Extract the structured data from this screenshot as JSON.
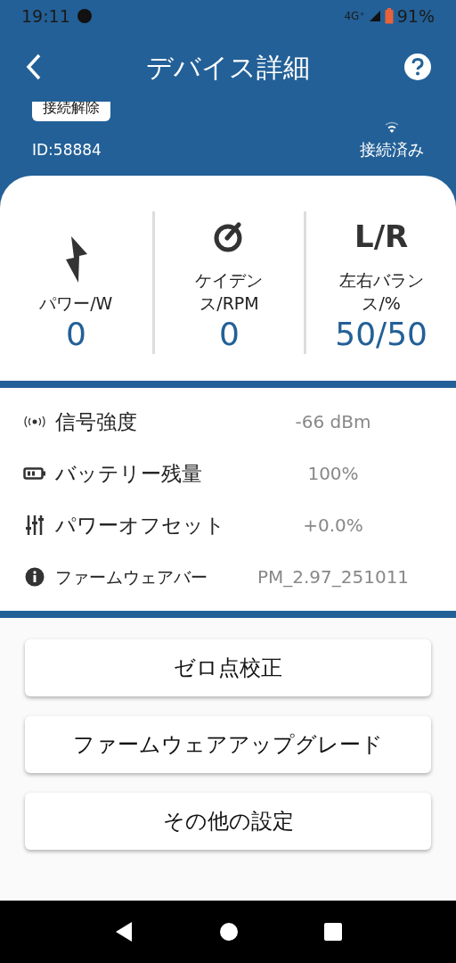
{
  "status_bar": {
    "time": "19:11",
    "network": "4G⁺",
    "battery": "91%"
  },
  "header": {
    "title": "デバイス詳細"
  },
  "device": {
    "disconnect_button": "接続解除",
    "id": "ID:58884",
    "connection": "接続済み"
  },
  "metrics": [
    {
      "kind": "power",
      "label": "パワー/W",
      "value": "0"
    },
    {
      "kind": "cadence",
      "label": "ケイデンス/RPM",
      "value": "0"
    },
    {
      "kind": "balance",
      "icon_text": "L/R",
      "label": "左右バランス/%",
      "value": "50/50"
    }
  ],
  "info": [
    {
      "kind": "signal",
      "label": "信号強度",
      "value": "-66 dBm"
    },
    {
      "kind": "battery",
      "label": "バッテリー残量",
      "value": "100%"
    },
    {
      "kind": "offset",
      "label": "パワーオフセット",
      "value": "+0.0%"
    },
    {
      "kind": "firmware",
      "label": "ファームウェアバー",
      "value": "PM_2.97_251011"
    }
  ],
  "buttons": [
    "ゼロ点校正",
    "ファームウェアアップグレード",
    "その他の設定"
  ]
}
